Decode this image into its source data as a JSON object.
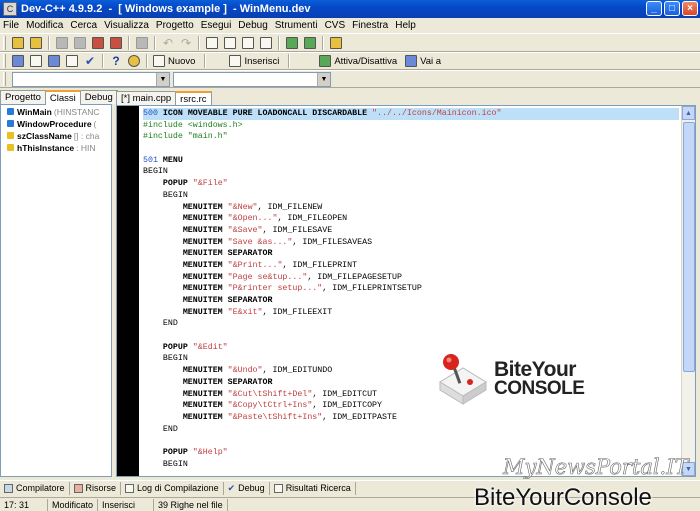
{
  "window": {
    "title": "Dev-C++ 4.9.9.2  -  [ Windows example ]  - WinMenu.dev"
  },
  "menu": [
    "File",
    "Modifica",
    "Cerca",
    "Visualizza",
    "Progetto",
    "Esegui",
    "Debug",
    "Strumenti",
    "CVS",
    "Finestra",
    "Help"
  ],
  "toolbar": {
    "nuovo": "Nuovo",
    "inserisci": "Inserisci",
    "attiva": "Attiva/Disattiva",
    "vai": "Vai a"
  },
  "left_tabs": [
    "Progetto",
    "Classi",
    "Debug"
  ],
  "class_tree": [
    {
      "name": "WinMain",
      "type": "(HINSTANC",
      "color": "#2a7ad8"
    },
    {
      "name": "WindowProcedure",
      "type": "(",
      "color": "#2a7ad8"
    },
    {
      "name": "szClassName",
      "type": "[] : cha",
      "color": "#e8c020"
    },
    {
      "name": "hThisInstance",
      "type": ": HIN",
      "color": "#e8c020"
    }
  ],
  "editor_tabs": [
    "[*] main.cpp",
    "rsrc.rc"
  ],
  "code_lines": [
    [
      {
        "t": "500 ",
        "c": "num"
      },
      {
        "t": "ICON MOVEABLE PURE LOADONCALL DISCARDABLE ",
        "c": "kw"
      },
      {
        "t": "\"../../Icons/Mainicon.ico\"",
        "c": "str"
      }
    ],
    [
      {
        "t": "#include <windows.h>",
        "c": "pp"
      }
    ],
    [
      {
        "t": "#include \"main.h\"",
        "c": "pp"
      }
    ],
    [],
    [
      {
        "t": "501 ",
        "c": "num"
      },
      {
        "t": "MENU",
        "c": "kw"
      }
    ],
    [
      {
        "t": "BEGIN",
        "c": ""
      }
    ],
    [
      {
        "t": "    POPUP ",
        "c": "kw"
      },
      {
        "t": "\"&File\"",
        "c": "str"
      }
    ],
    [
      {
        "t": "    BEGIN",
        "c": ""
      }
    ],
    [
      {
        "t": "        MENUITEM ",
        "c": "kw"
      },
      {
        "t": "\"&New\"",
        "c": "str"
      },
      {
        "t": ", IDM_FILENEW",
        "c": ""
      }
    ],
    [
      {
        "t": "        MENUITEM ",
        "c": "kw"
      },
      {
        "t": "\"&Open...\"",
        "c": "str"
      },
      {
        "t": ", IDM_FILEOPEN",
        "c": ""
      }
    ],
    [
      {
        "t": "        MENUITEM ",
        "c": "kw"
      },
      {
        "t": "\"&Save\"",
        "c": "str"
      },
      {
        "t": ", IDM_FILESAVE",
        "c": ""
      }
    ],
    [
      {
        "t": "        MENUITEM ",
        "c": "kw"
      },
      {
        "t": "\"Save &as...\"",
        "c": "str"
      },
      {
        "t": ", IDM_FILESAVEAS",
        "c": ""
      }
    ],
    [
      {
        "t": "        MENUITEM SEPARATOR",
        "c": "kw"
      }
    ],
    [
      {
        "t": "        MENUITEM ",
        "c": "kw"
      },
      {
        "t": "\"&Print...\"",
        "c": "str"
      },
      {
        "t": ", IDM_FILEPRINT",
        "c": ""
      }
    ],
    [
      {
        "t": "        MENUITEM ",
        "c": "kw"
      },
      {
        "t": "\"Page se&tup...\"",
        "c": "str"
      },
      {
        "t": ", IDM_FILEPAGESETUP",
        "c": ""
      }
    ],
    [
      {
        "t": "        MENUITEM ",
        "c": "kw"
      },
      {
        "t": "\"P&rinter setup...\"",
        "c": "str"
      },
      {
        "t": ", IDM_FILEPRINTSETUP",
        "c": ""
      }
    ],
    [
      {
        "t": "        MENUITEM SEPARATOR",
        "c": "kw"
      }
    ],
    [
      {
        "t": "        MENUITEM ",
        "c": "kw"
      },
      {
        "t": "\"E&xit\"",
        "c": "str"
      },
      {
        "t": ", IDM_FILEEXIT",
        "c": ""
      }
    ],
    [
      {
        "t": "    END",
        "c": ""
      }
    ],
    [],
    [
      {
        "t": "    POPUP ",
        "c": "kw"
      },
      {
        "t": "\"&Edit\"",
        "c": "str"
      }
    ],
    [
      {
        "t": "    BEGIN",
        "c": ""
      }
    ],
    [
      {
        "t": "        MENUITEM ",
        "c": "kw"
      },
      {
        "t": "\"&Undo\"",
        "c": "str"
      },
      {
        "t": ", IDM_EDITUNDO",
        "c": ""
      }
    ],
    [
      {
        "t": "        MENUITEM SEPARATOR",
        "c": "kw"
      }
    ],
    [
      {
        "t": "        MENUITEM ",
        "c": "kw"
      },
      {
        "t": "\"&Cut\\tShift+Del\"",
        "c": "str"
      },
      {
        "t": ", IDM_EDITCUT",
        "c": ""
      }
    ],
    [
      {
        "t": "        MENUITEM ",
        "c": "kw"
      },
      {
        "t": "\"&Copy\\tCtrl+Ins\"",
        "c": "str"
      },
      {
        "t": ", IDM_EDITCOPY",
        "c": ""
      }
    ],
    [
      {
        "t": "        MENUITEM ",
        "c": "kw"
      },
      {
        "t": "\"&Paste\\tShift+Ins\"",
        "c": "str"
      },
      {
        "t": ", IDM_EDITPASTE",
        "c": ""
      }
    ],
    [
      {
        "t": "    END",
        "c": ""
      }
    ],
    [],
    [
      {
        "t": "    POPUP ",
        "c": "kw"
      },
      {
        "t": "\"&Help\"",
        "c": "str"
      }
    ],
    [
      {
        "t": "    BEGIN",
        "c": ""
      }
    ]
  ],
  "bottom_tabs": [
    "Compilatore",
    "Risorse",
    "Log di Compilazione",
    "Debug",
    "Risultati Ricerca"
  ],
  "status": {
    "position": "17: 31",
    "mode": "Modificato",
    "insert": "Inserisci",
    "lines": "39 Righe nel file"
  },
  "watermark": {
    "logo_line1": "BiteYour",
    "logo_line2": "CONSOLE",
    "portal": "MyNewsPortal.IT",
    "site": "BiteYourConsole"
  },
  "colors": {
    "titlebar": "#0548c8",
    "line_highlight": "#bde0f8",
    "keyword": "#000000",
    "number": "#2050c8",
    "string": "#c04040",
    "preproc": "#208020"
  }
}
